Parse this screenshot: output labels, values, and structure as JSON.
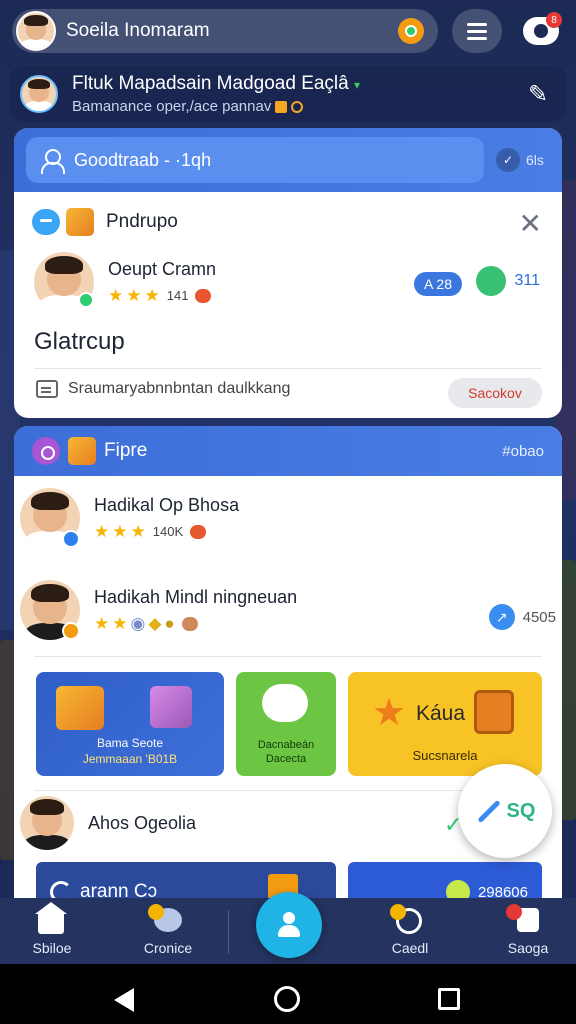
{
  "top_bar": {
    "search_text": "Soeila Inomaram",
    "notification_count": "8"
  },
  "profile_banner": {
    "title": "Fltuk Mapadsain Madgoad Eaçlâ",
    "online_mark": "▾",
    "subtitle": "Bamanance oper,/ace pannav"
  },
  "card1": {
    "search_placeholder": "Goodtraab - ·1qh",
    "head_right_label": "6ls",
    "section_title": "Pndrupo",
    "user_name": "Oeupt Cramn",
    "user_rating": "141",
    "pill_label": "A 28",
    "green_count": "311",
    "big_label": "Glatrcup",
    "footer_text": "Sraumaryabnnbntan daulkkang",
    "action_label": "Sacokov"
  },
  "card2": {
    "title": "Fipre",
    "right_label": "#obao",
    "items": [
      {
        "name": "Hadikal Op Bhosa",
        "rating": "140K"
      },
      {
        "name": "Hadikah Mindl ningneuan",
        "count": "4505"
      }
    ],
    "tiles": {
      "blue": {
        "line1": "Bama Seote",
        "line2": "Jemmaaan 'B01B"
      },
      "green": {
        "line1": "Dacnabeán",
        "line2": "Dacecta"
      },
      "yellow": {
        "label": "Káua",
        "sub": "Sucsnarela"
      }
    },
    "bottom_item_name": "Ahos Ogeolia",
    "row_left_text": "arann Cɔ",
    "row_right_text": "298606",
    "fab_label": "SQ"
  },
  "bottom_nav": {
    "items": [
      {
        "label": "Sbiloe"
      },
      {
        "label": "Cronice"
      },
      {
        "label": "Caedl"
      },
      {
        "label": "Saoga"
      }
    ]
  },
  "colors": {
    "accent_blue": "#3d6ed8",
    "fab_green": "#2fb38a",
    "nav_center": "#1fb3e6",
    "badge_red": "#e53935"
  }
}
